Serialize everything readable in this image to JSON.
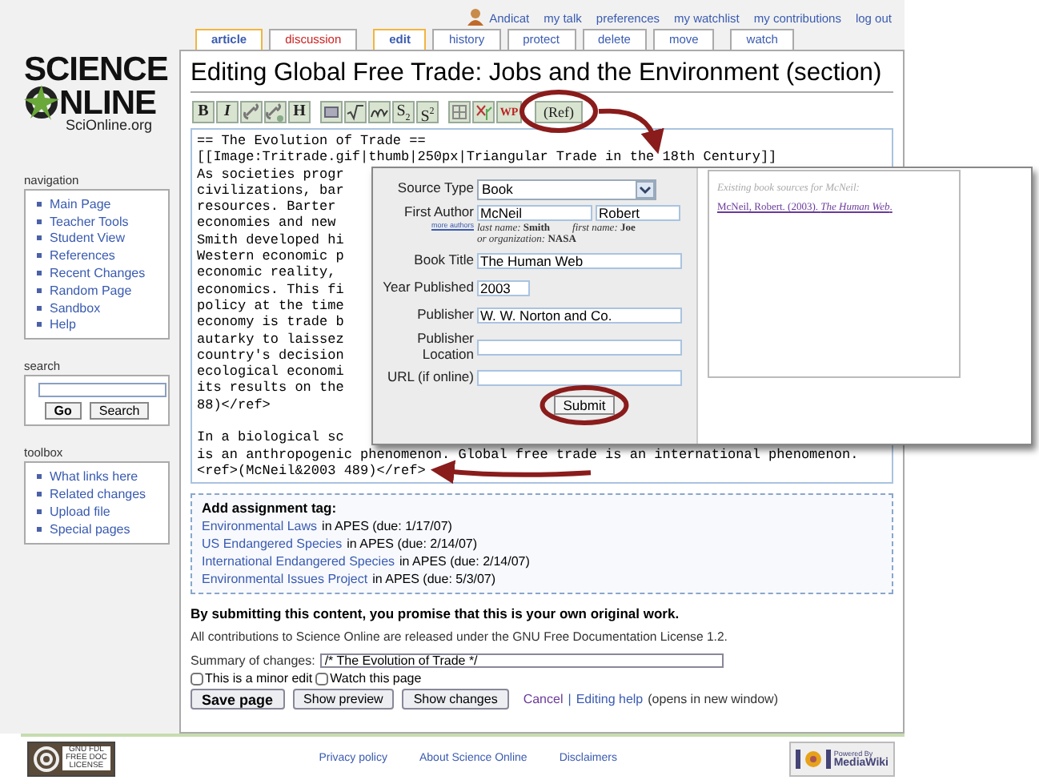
{
  "logo": {
    "line1": "SCIENCE",
    "line2": "NLINE",
    "domain": "SciOnline.org"
  },
  "personal": {
    "user": "Andicat",
    "links": [
      "my talk",
      "preferences",
      "my watchlist",
      "my contributions",
      "log out"
    ]
  },
  "tab_groups": [
    [
      {
        "label": "article",
        "selected": true,
        "missing": false
      },
      {
        "label": "discussion",
        "selected": false,
        "missing": true
      }
    ],
    [
      {
        "label": "edit",
        "selected": true,
        "missing": false
      },
      {
        "label": "history",
        "selected": false,
        "missing": false
      },
      {
        "label": "protect",
        "selected": false,
        "missing": false
      },
      {
        "label": "delete",
        "selected": false,
        "missing": false
      },
      {
        "label": "move",
        "selected": false,
        "missing": false
      }
    ],
    [
      {
        "label": "watch",
        "selected": false,
        "missing": false
      }
    ]
  ],
  "title": "Editing Global Free Trade: Jobs and the Environment (section)",
  "toolbar": [
    [
      {
        "kind": "text",
        "label": "B"
      },
      {
        "kind": "text",
        "label": "I"
      },
      {
        "kind": "icon"
      },
      {
        "kind": "icon"
      },
      {
        "kind": "text",
        "label": "H"
      }
    ],
    [
      {
        "kind": "icon"
      },
      {
        "kind": "icon"
      },
      {
        "kind": "icon"
      },
      {
        "kind": "text",
        "label": "S$_{2}$"
      },
      {
        "kind": "text",
        "label": "S$^{2}$"
      }
    ],
    [
      {
        "kind": "icon"
      },
      {
        "kind": "icon"
      },
      {
        "kind": "text",
        "label": "WP"
      }
    ],
    [
      {
        "kind": "text",
        "label": "(Ref)"
      }
    ]
  ],
  "editor": {
    "paragraphs": [
      [
        "== The Evolution of Trade ==",
        "[[Image:Tritrade.gif|thumb|250px|Triangular Trade in the 18th Century]]",
        "As societies progr",
        "civilizations, bar",
        "resources. Barter",
        "economies and new",
        "Smith developed hi",
        "Western economic p",
        "economic reality,",
        "economics. This fi",
        "policy at the time",
        "economy is trade b",
        "autarky to laissez",
        "country's decision",
        "ecological economi",
        "its results on the",
        "88)</ref>"
      ],
      [
        "In a biological sc",
        "is an anthropogenic phenomenon. Global free trade is an international phenomenon.",
        "<ref>(McNeil&2003 489)</ref>"
      ]
    ]
  },
  "cite_form": {
    "source_type": {
      "label": "Source Type",
      "value": "Book"
    },
    "author": {
      "label": "First Author",
      "last": "McNeil",
      "first": "Robert",
      "more": "more authors",
      "hint_last": "*last name:* **Smith**",
      "hint_first": "*first name:* **Joe**",
      "hint_org": "*or organization:* **NASA**"
    },
    "fields": [
      {
        "label": "Book Title",
        "value": "The Human Web"
      },
      {
        "label": "Year Published",
        "value": "2003"
      },
      {
        "label": "Publisher",
        "value": "W. W. Norton and Co."
      },
      {
        "label": "Publisher Location"
      },
      {
        "label": "URL (if online)"
      }
    ],
    "submit": "Submit",
    "existing_heading": "Existing book sources for McNeil:",
    "existing": [
      "McNeil, Robert. (2003). *The Human Web*."
    ]
  },
  "assignment": {
    "heading": "Add assignment tag:",
    "items": [
      {
        "link": "Environmental Laws",
        "rest": "in APES (due: 1/17/07)"
      },
      {
        "link": "US Endangered Species",
        "rest": "in APES (due: 2/14/07)"
      },
      {
        "link": "International Endangered Species",
        "rest": "in APES (due: 2/14/07)"
      },
      {
        "link": "Environmental Issues Project",
        "rest": "in APES (due: 5/3/07)"
      }
    ]
  },
  "notice": "By submitting this content, you promise that this is your own original work.",
  "license": "All contributions to Science Online are released under the GNU Free Documentation License 1.2.",
  "summary": {
    "label": "Summary of changes:",
    "value": "/* The Evolution of Trade */"
  },
  "checkboxes": [
    {
      "label": "This is a minor edit",
      "checked": false
    },
    {
      "label": "Watch this page",
      "checked": false
    }
  ],
  "buttons": [
    {
      "label": "Save page",
      "primary": true
    },
    {
      "label": "Show preview",
      "primary": false
    },
    {
      "label": "Show changes",
      "primary": false
    }
  ],
  "edit_links": {
    "cancel": "Cancel",
    "separator": "|",
    "help": "Editing help",
    "note": "(opens in new window)"
  },
  "sidebar": [
    {
      "heading": "navigation",
      "kind": "links",
      "items": [
        "Main Page",
        "Teacher Tools",
        "Student View",
        "References",
        "Recent Changes",
        "Random Page",
        "Sandbox",
        "Help"
      ]
    },
    {
      "heading": "search",
      "kind": "search",
      "buttons": [
        "Go",
        "Search"
      ]
    },
    {
      "heading": "toolbox",
      "kind": "links",
      "items": [
        "What links here",
        "Related changes",
        "Upload file",
        "Special pages"
      ]
    }
  ],
  "footer": {
    "fdl": [
      "GNU FDL",
      "FREE DOC",
      "LICENSE"
    ],
    "links": [
      "Privacy policy",
      "About Science Online",
      "Disclaimers"
    ],
    "powered": [
      "Powered By",
      "MediaWiki"
    ]
  }
}
